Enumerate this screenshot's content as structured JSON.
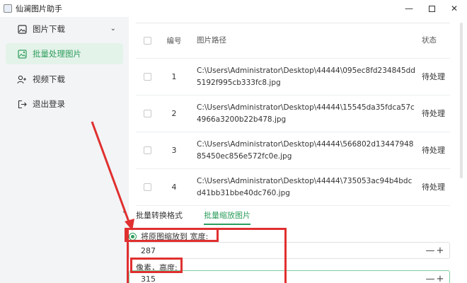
{
  "window": {
    "title": "仙澜图片助手",
    "minimize": "—",
    "close": "✕"
  },
  "sidebar": {
    "items": [
      {
        "label": "图片下载",
        "icon": "image-icon"
      },
      {
        "label": "批量处理图片",
        "icon": "image-edit-icon"
      },
      {
        "label": "视频下载",
        "icon": "user-plus-icon"
      },
      {
        "label": "退出登录",
        "icon": "logout-icon"
      }
    ],
    "chevron": "⌄",
    "collapse": "‹"
  },
  "table": {
    "headers": {
      "num": "编号",
      "path": "图片路径",
      "status": "状态"
    },
    "rows": [
      {
        "num": "1",
        "path": "C:\\Users\\Administrator\\Desktop\\44444\\095ec8fd234845dd5192f995cb333fc8.jpg",
        "status": "待处理"
      },
      {
        "num": "2",
        "path": "C:\\Users\\Administrator\\Desktop\\44444\\15545da35fdca57c4966a3200b22b478.jpg",
        "status": "待处理"
      },
      {
        "num": "3",
        "path": "C:\\Users\\Administrator\\Desktop\\44444\\566802d1344794885450ec856e572fc0e.jpg",
        "status": "待处理"
      },
      {
        "num": "4",
        "path": "C:\\Users\\Administrator\\Desktop\\44444\\735053ac94b4bdcd41bb31bbe40dc760.jpg",
        "status": "待处理"
      }
    ]
  },
  "tabs": [
    "批量转换格式",
    "批量缩放图片"
  ],
  "form": {
    "radio_label": "将原图缩放到 宽度:",
    "width_value": "287",
    "height_label": "像素，高度:",
    "height_value": "315",
    "minus": "—",
    "plus": "+"
  },
  "colors": {
    "accent": "#2d9d5c",
    "annotation": "#e03030"
  }
}
